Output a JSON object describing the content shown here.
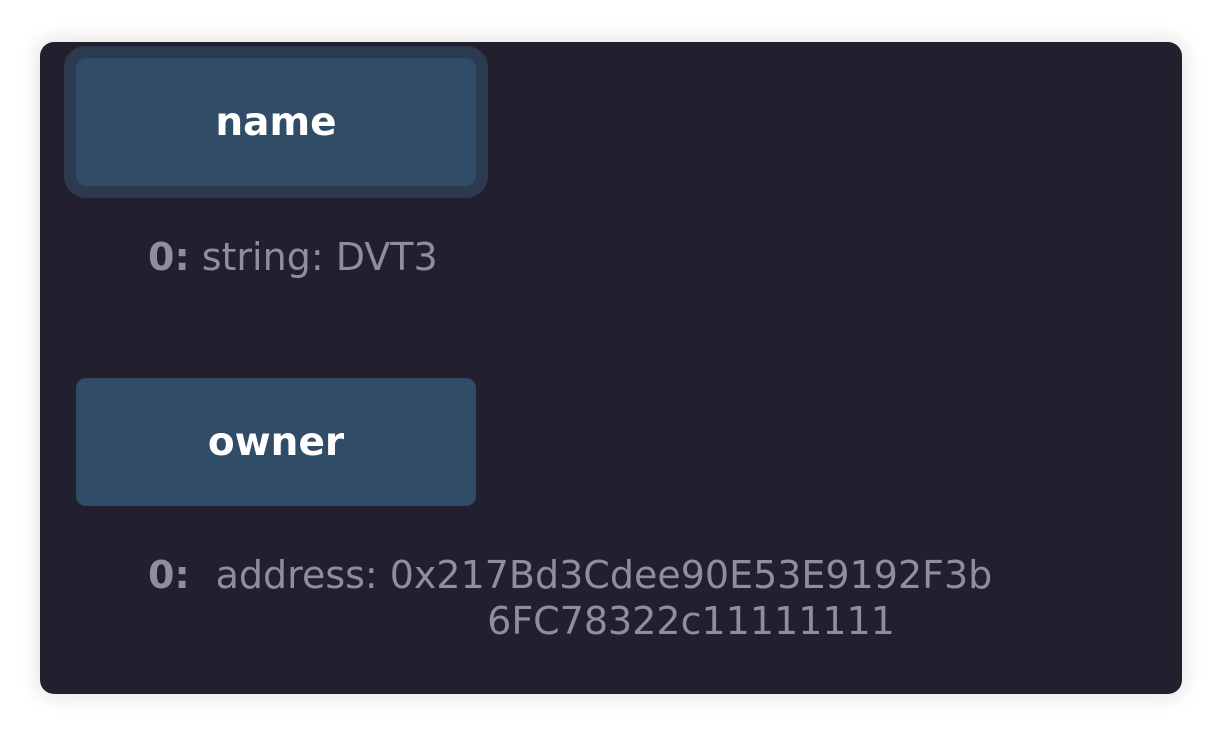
{
  "functions": [
    {
      "button_label": "name",
      "output": {
        "index": "0:",
        "type_label": "string:",
        "value": "DVT3"
      }
    },
    {
      "button_label": "owner",
      "output": {
        "index": "0:",
        "type_label": "address:",
        "value_line1": "0x217Bd3Cdee90E53E9192F3b",
        "value_line2": "6FC78322c11111111"
      }
    }
  ],
  "colors": {
    "panel_bg": "#22202f",
    "button_bg": "#304c67",
    "button_text": "#ffffff",
    "output_text": "#8d8f9b"
  }
}
